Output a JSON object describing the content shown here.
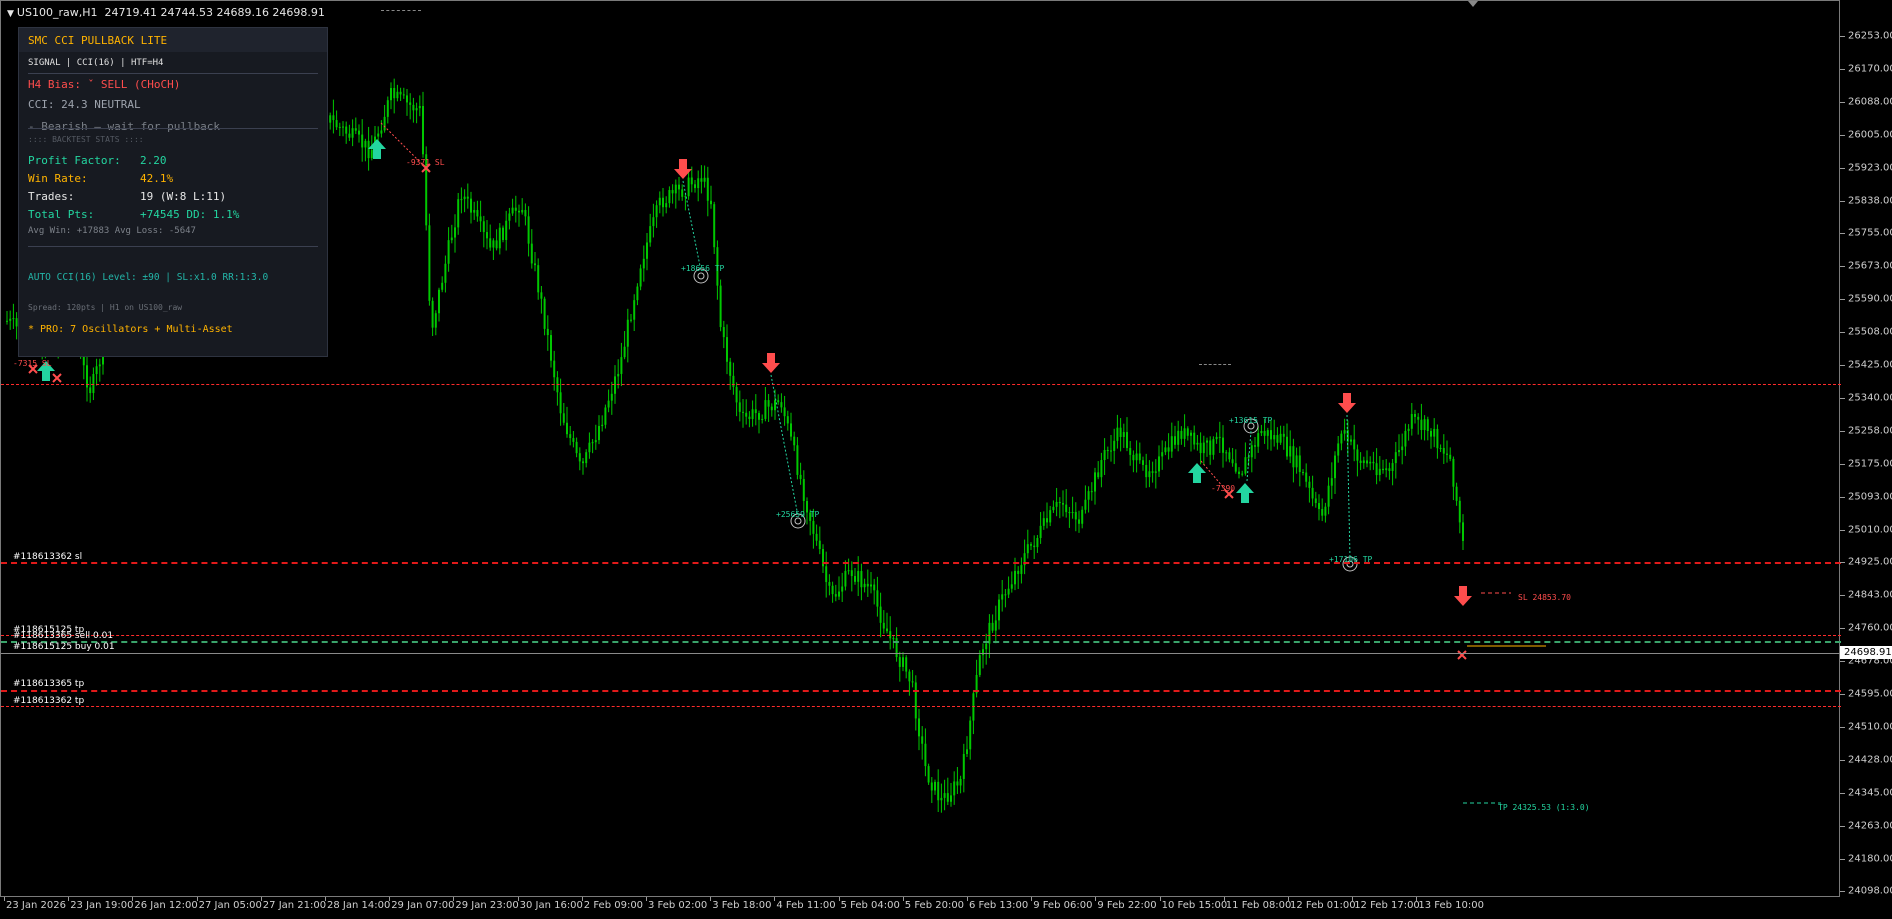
{
  "window": {
    "title": "US100_raw,H1",
    "ohlc": "24719.41 24744.53 24689.16 24698.91"
  },
  "colors": {
    "background": "#000000",
    "candle": "#00c800",
    "sell_arrow": "#ff4d4d",
    "buy_arrow": "#23d5a0",
    "red_level": "#ff2b2b",
    "panel_bg": "#171a21",
    "accent": "#ffb300"
  },
  "price_axis": {
    "labels": [
      "26253.00",
      "26170.00",
      "26088.00",
      "26005.00",
      "25923.00",
      "25838.00",
      "25755.00",
      "25673.00",
      "25590.00",
      "25508.00",
      "25425.00",
      "25340.00",
      "25258.00",
      "25175.00",
      "25093.00",
      "25010.00",
      "24925.00",
      "24843.00",
      "24760.00",
      "24678.00",
      "24595.00",
      "24510.00",
      "24428.00",
      "24345.00",
      "24263.00",
      "24180.00",
      "24098.00"
    ],
    "current_price": "24698.91"
  },
  "time_axis": {
    "labels": [
      "23 Jan 2026",
      "23 Jan 19:00",
      "26 Jan 12:00",
      "27 Jan 05:00",
      "27 Jan 21:00",
      "28 Jan 14:00",
      "29 Jan 07:00",
      "29 Jan 23:00",
      "30 Jan 16:00",
      "2 Feb 09:00",
      "3 Feb 02:00",
      "3 Feb 18:00",
      "4 Feb 11:00",
      "5 Feb 04:00",
      "5 Feb 20:00",
      "6 Feb 13:00",
      "9 Feb 06:00",
      "9 Feb 22:00",
      "10 Feb 15:00",
      "11 Feb 08:00",
      "12 Feb 01:00",
      "12 Feb 17:00",
      "13 Feb 10:00"
    ]
  },
  "panel": {
    "title": "SMC CCI PULLBACK LITE",
    "subtitle": "SIGNAL | CCI(16) | HTF=H4",
    "bias": "H4 Bias: ˇ SELL (CHoCH)",
    "cci": "CCI: 24.3 NEUTRAL",
    "wait": "- Bearish — wait for pullback",
    "backtest_header": ":::: BACKTEST STATS ::::",
    "stats": [
      {
        "label": "Profit Factor:",
        "value": "2.20",
        "style": "green"
      },
      {
        "label": "Win Rate:",
        "value": "42.1%",
        "style": "yellow"
      },
      {
        "label": "Trades:",
        "value": "19  (W:8  L:11)",
        "style": "white"
      },
      {
        "label": "Total Pts:",
        "value": "+74545    DD: 1.1%",
        "style": "green"
      }
    ],
    "avg": "Avg Win:  +17883    Avg Loss: -5647",
    "auto": "AUTO CCI(16) Level: ±90 | SL:x1.0 RR:1:3.0",
    "spread": "Spread: 120pts | H1 on US100_raw",
    "pro": "* PRO: 7 Oscillators + Multi-Asset"
  },
  "orders": [
    {
      "id": "#118613362 sl",
      "price": 24930
    },
    {
      "id": "#118615125 tp",
      "price": 24750
    },
    {
      "id": "#118613365 sell 0.01",
      "price": 24743
    },
    {
      "id": "#118615125 buy 0.01",
      "price": 24712
    },
    {
      "id": "#118613365 tp",
      "price": 24617
    },
    {
      "id": "#118613362 tp",
      "price": 24595
    }
  ],
  "signal_labels": [
    {
      "text": "-7315 SL",
      "color": "#ff4d4d"
    },
    {
      "text": "-9371 SL",
      "color": "#ff4d4d"
    },
    {
      "text": "+18656 TP",
      "color": "#23d5a0"
    },
    {
      "text": "+25659 TP",
      "color": "#23d5a0"
    },
    {
      "text": "+13615 TP",
      "color": "#23d5a0"
    },
    {
      "text": "-7390",
      "color": "#ff4d4d"
    },
    {
      "text": "+17106 TP",
      "color": "#23d5a0"
    },
    {
      "text": "SL 24853.70",
      "color": "#ff4d4d"
    },
    {
      "text": "TP 24325.53 (1:3.0)",
      "color": "#23d5a0"
    }
  ]
}
